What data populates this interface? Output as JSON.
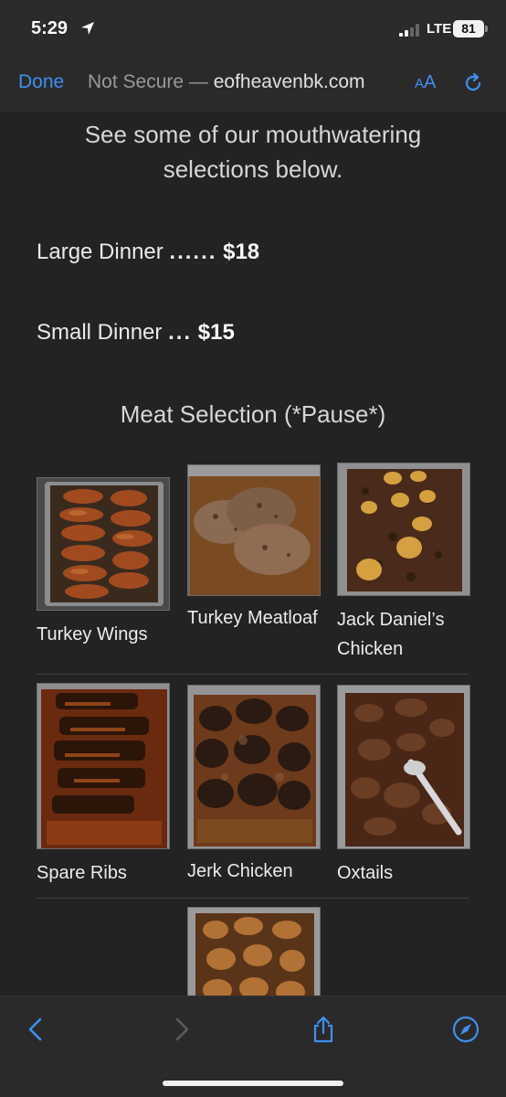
{
  "status": {
    "time": "5:29",
    "network": "LTE",
    "battery": "81"
  },
  "browser": {
    "done_label": "Done",
    "url_prefix": "Not Secure — ",
    "url_domain": "eofheavenbk.com",
    "aa_small": "A",
    "aa_large": "A"
  },
  "page": {
    "intro": "See some of our mouthwatering selections below.",
    "prices": [
      {
        "label": "Large Dinner",
        "dots": "......",
        "price": "$18"
      },
      {
        "label": "Small Dinner",
        "dots": "...",
        "price": "$15"
      }
    ],
    "section_title": "Meat Selection (*Pause*)",
    "items": [
      {
        "name": "Turkey Wings"
      },
      {
        "name": "Turkey Meatloaf"
      },
      {
        "name": "Jack Daniel’s Chicken"
      },
      {
        "name": "Spare Ribs"
      },
      {
        "name": "Jerk Chicken"
      },
      {
        "name": "Oxtails"
      },
      {
        "name": ""
      }
    ]
  },
  "icons": {
    "location": "location-arrow-icon",
    "signal": "cellular-signal-icon",
    "reload": "reload-icon",
    "back": "back-chevron-icon",
    "forward": "forward-chevron-icon",
    "share": "share-icon",
    "compass": "compass-icon"
  },
  "colors": {
    "accent": "#3f8ff0",
    "background": "#232323",
    "bar": "#2a2a2a"
  }
}
